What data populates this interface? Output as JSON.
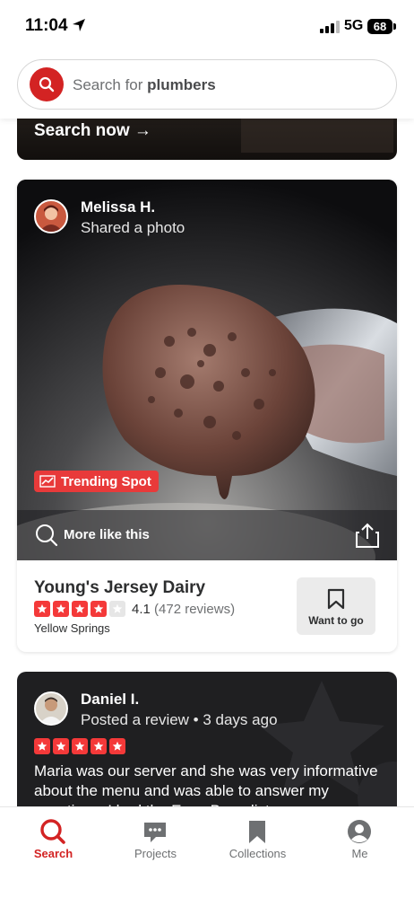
{
  "status_bar": {
    "time": "11:04",
    "network": "5G",
    "battery": "68"
  },
  "search": {
    "prefix": "Search for ",
    "keyword": "plumbers"
  },
  "promo_card": {
    "cta": "Search now →"
  },
  "photo_card": {
    "user_name": "Melissa H.",
    "action": "Shared a photo",
    "badge": "Trending Spot",
    "more_like_this": "More like this",
    "business": {
      "name": "Young's Jersey Dairy",
      "rating": "4.1",
      "reviews": "(472 reviews)",
      "stars_filled": 4,
      "stars_total": 5,
      "location": "Yellow Springs"
    },
    "want_to_go": "Want to go"
  },
  "review_card": {
    "user_name": "Daniel I.",
    "action": "Posted a review • 3 days ago",
    "stars_filled": 5,
    "text": "Maria was our server and she was very informative about the menu and was able to answer my questions. I had the Eggs Benedict"
  },
  "tabs": [
    {
      "label": "Search",
      "icon": "search-icon",
      "active": true
    },
    {
      "label": "Projects",
      "icon": "projects-icon",
      "active": false
    },
    {
      "label": "Collections",
      "icon": "bookmark-icon",
      "active": false
    },
    {
      "label": "Me",
      "icon": "profile-icon",
      "active": false
    }
  ],
  "colors": {
    "brand_red": "#d32323",
    "star_red": "#f43939",
    "badge_red": "#e83a3a"
  }
}
